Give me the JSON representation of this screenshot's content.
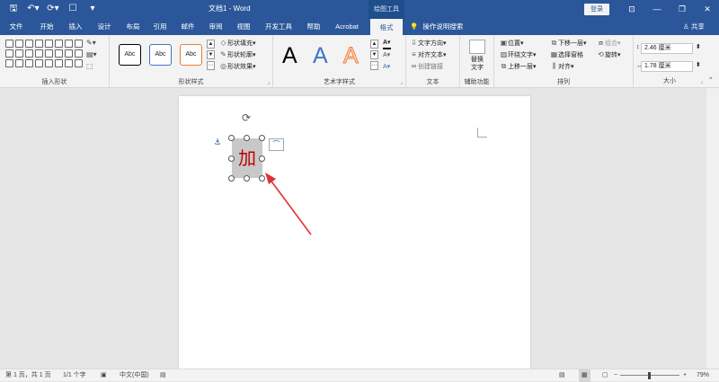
{
  "titlebar": {
    "doc_title": "文档1 - Word",
    "context_tool": "绘图工具",
    "login_label": "登录",
    "qat_icons": [
      "save-icon",
      "undo-icon",
      "redo-icon",
      "touch-mode-icon",
      "customize-icon"
    ],
    "qat_glyphs": {
      "save": "🖫",
      "undo": "↶▾",
      "redo": "⟳▾",
      "touch": "☐",
      "customize": "▾"
    },
    "window_glyphs": {
      "ribbon_display": "⊡",
      "minimize": "—",
      "restore": "❐",
      "close": "✕"
    }
  },
  "tabs": {
    "items": [
      "文件",
      "开始",
      "插入",
      "设计",
      "布局",
      "引用",
      "邮件",
      "审阅",
      "视图",
      "开发工具",
      "帮助",
      "Acrobat",
      "格式"
    ],
    "active": "格式",
    "tell_me": "操作说明搜索",
    "tell_me_glyph": "💡",
    "share": "共享",
    "share_glyph": "♙"
  },
  "ribbon": {
    "insert_shapes": {
      "label": "插入形状",
      "edit_shape_glyph": "✎▾",
      "text_box_glyph": "▤▾",
      "merge_glyph": "⬚"
    },
    "shape_styles": {
      "label": "形状样式",
      "presets": [
        "Abc",
        "Abc",
        "Abc"
      ],
      "preset_colors": [
        "#000000",
        "#4472c4",
        "#ed7d31"
      ],
      "gallery_arrows": [
        "▲",
        "▼",
        "⋯"
      ],
      "fill": "形状填充",
      "outline": "形状轮廓",
      "effects": "形状效果",
      "fill_glyph": "◇",
      "outline_glyph": "✎",
      "effects_glyph": "◎",
      "dropdown_glyph": "▾",
      "launcher_glyph": "⌟"
    },
    "wordart": {
      "label": "艺术字样式",
      "letters": [
        "A",
        "A",
        "A"
      ],
      "letter_colors": [
        "#000000",
        "#4472c4",
        "#ffffff"
      ],
      "letter_outline_colors": [
        "",
        "",
        "#ed7d31"
      ],
      "text_fill_glyph": "A▾",
      "text_outline_glyph": "A▾",
      "text_effects_glyph": "A▾",
      "text_fill_bar_color": "#000000",
      "launcher_glyph": "⌟"
    },
    "text": {
      "label": "文本",
      "direction": "文字方向",
      "align": "对齐文本",
      "link": "创建链接",
      "direction_glyph": "⇩",
      "align_glyph": "≡",
      "link_glyph": "∞",
      "dropdown_glyph": "▾"
    },
    "aux": {
      "label": "辅助功能",
      "alt_text_line1": "替换",
      "alt_text_line2": "文字"
    },
    "arrange": {
      "label": "排列",
      "position": "位置",
      "wrap": "环绕文字",
      "bring_forward": "上移一层",
      "send_backward": "下移一层",
      "selection_pane": "选择窗格",
      "align": "对齐",
      "group": "组合",
      "rotate": "旋转",
      "dropdown_glyph": "▾",
      "icon_glyphs": {
        "position": "▣",
        "wrap": "▨",
        "forward": "⧉",
        "backward": "⧉",
        "selection": "▦",
        "align": "⫼",
        "group": "⧈",
        "rotate": "⟲"
      }
    },
    "size": {
      "label": "大小",
      "height": "2.46 厘米",
      "width": "1.78 厘米",
      "height_glyph": "↕",
      "width_glyph": "↔",
      "spinner_glyph": "⬍",
      "launcher_glyph": "⌟"
    },
    "collapse_glyph": "⌃"
  },
  "document": {
    "shape_text": "加",
    "shape_fill": "#c8c8c8",
    "text_color": "#c00000",
    "arrow_color": "#e03030",
    "rotate_glyph": "⟳",
    "anchor_glyph": "⚓",
    "layout_options_glyph": "⌒"
  },
  "status": {
    "page": "第 1 页，共 1 页",
    "words": "1/1 个字",
    "language": "中文(中国)",
    "zoom": "79%",
    "proofing_glyph": "▣",
    "accessibility_glyph": "▤",
    "zoom_out_glyph": "−",
    "zoom_in_glyph": "+",
    "view_glyphs": {
      "read": "▤",
      "print": "▦",
      "web": "▢"
    },
    "zoom_fraction": 0.48
  }
}
